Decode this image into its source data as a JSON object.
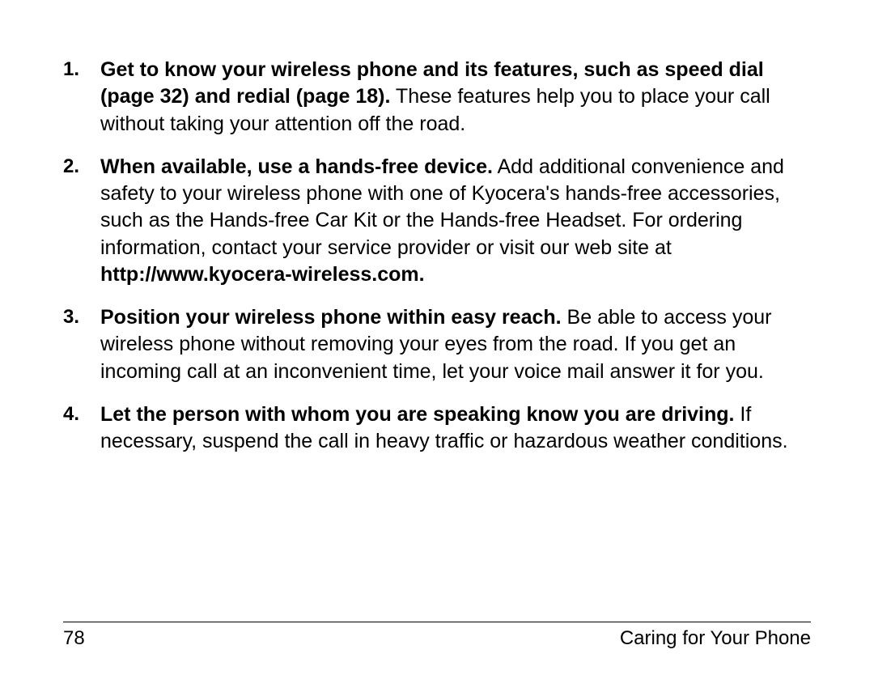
{
  "items": [
    {
      "bold": "Get to know your wireless phone and its features, such as speed dial (page 32) and redial (page 18).",
      "rest": " These features help you to place your call without taking your attention off the road."
    },
    {
      "bold": "When available, use a hands-free device.",
      "rest1": " Add additional convenience and safety to your wireless phone with one of Kyocera's hands-free accessories, such as the Hands-free Car Kit or the Hands-free Headset. For ordering information, contact your service provider or visit our web site at ",
      "url": "http://www.kyocera-wireless.com."
    },
    {
      "bold": "Position your wireless phone within easy reach.",
      "rest": " Be able to access your wireless phone without removing your eyes from the road. If you get an incoming call at an inconvenient time, let your voice mail answer it for you."
    },
    {
      "bold": "Let the person with whom you are speaking know you are driving.",
      "rest": " If necessary, suspend the call in heavy traffic or hazardous weather conditions."
    }
  ],
  "footer": {
    "page_number": "78",
    "section": "Caring for Your Phone"
  }
}
